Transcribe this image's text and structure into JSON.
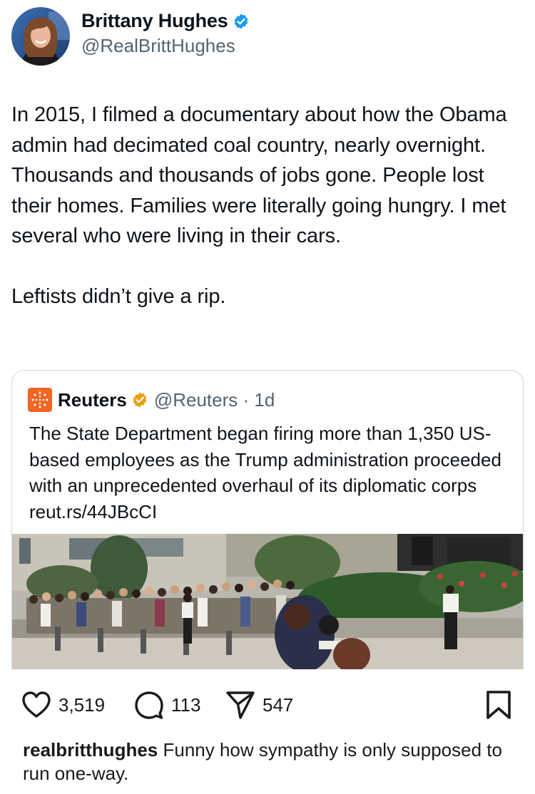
{
  "tweet": {
    "author": {
      "display_name": "Brittany Hughes",
      "handle": "@RealBrittHughes",
      "verified_color": "#1d9bf0"
    },
    "text_paragraph_1": "In 2015, I filmed a documentary about how the Obama admin had decimated coal country, nearly overnight. Thousands and thousands of jobs gone. People lost their homes. Families were literally going hungry. I met several who were living in their cars.",
    "text_paragraph_2": "Leftists didn’t give a rip."
  },
  "quoted_tweet": {
    "author_name": "Reuters",
    "handle_time": "@Reuters · 1d",
    "text": "The State Department began firing more than 1,350 US-based employees as the Trump administration proceeded with an unprecedented overhaul of its diplomatic corps reut.rs/44JBcCI",
    "brand_color": "#f26522",
    "verified_color": "#e8a317"
  },
  "actions": {
    "likes": "3,519",
    "comments": "113",
    "shares": "547",
    "icons": [
      "heart-icon",
      "comment-icon",
      "send-icon",
      "bookmark-icon"
    ]
  },
  "caption": {
    "username": "realbritthughes",
    "text": " Funny how sympathy is only supposed to run one-way."
  }
}
